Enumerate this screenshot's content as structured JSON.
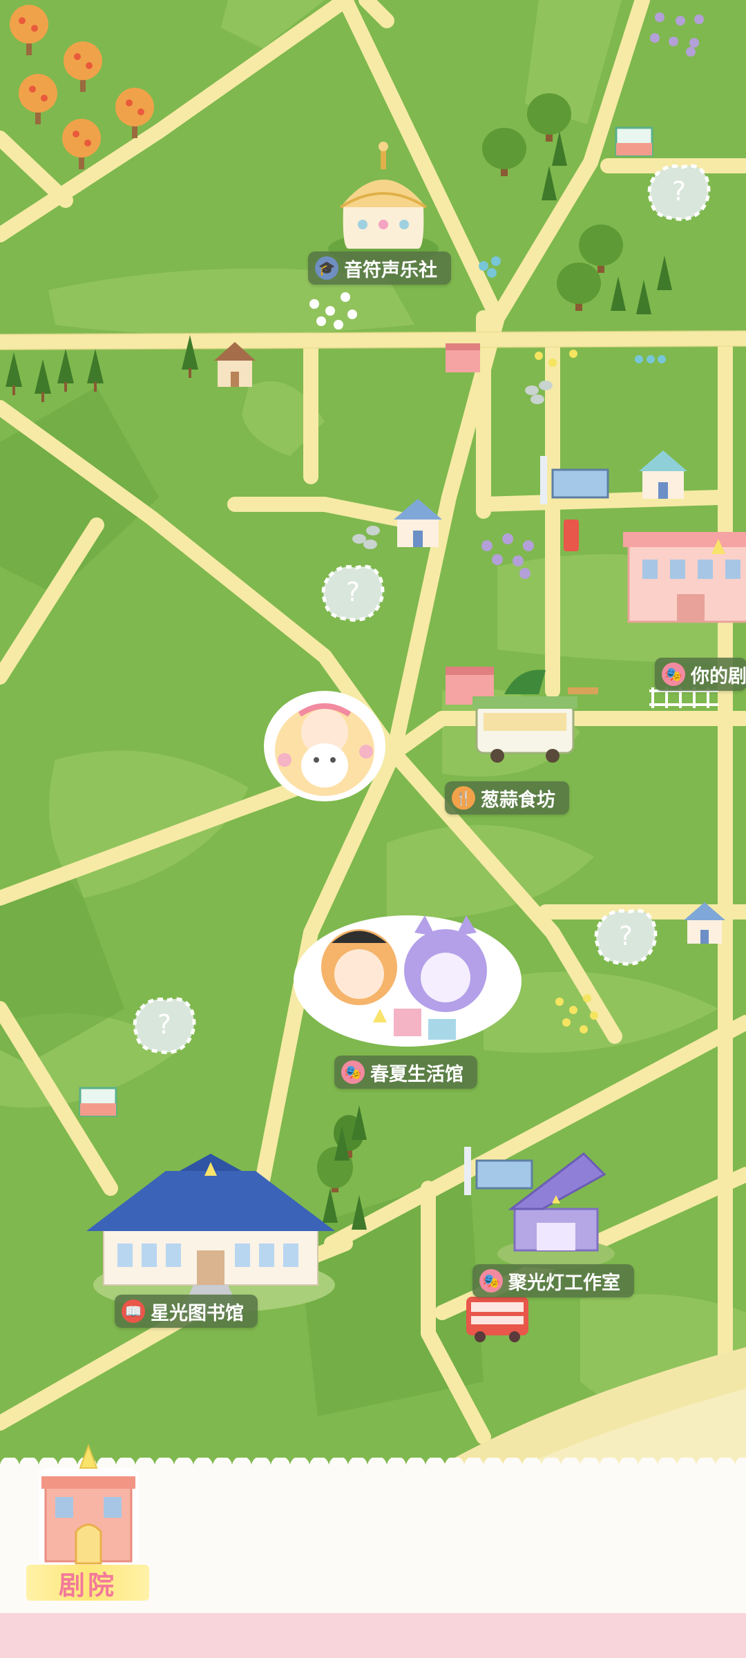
{
  "locations": {
    "music_club": "音符声乐社",
    "restaurant": "葱蒜食坊",
    "spring_summer": "春夏生活馆",
    "library": "星光图书馆",
    "workshop": "聚光灯工作室",
    "yours": "你的剧"
  },
  "mystery_mark": "?",
  "bottom_tab": {
    "theater_label": "剧院"
  },
  "colors": {
    "grass": "#7fb84e",
    "road": "#f6eaa6",
    "label_bg": "#587646",
    "panel": "#fdfbf8",
    "accent_pink": "#f2799a"
  }
}
